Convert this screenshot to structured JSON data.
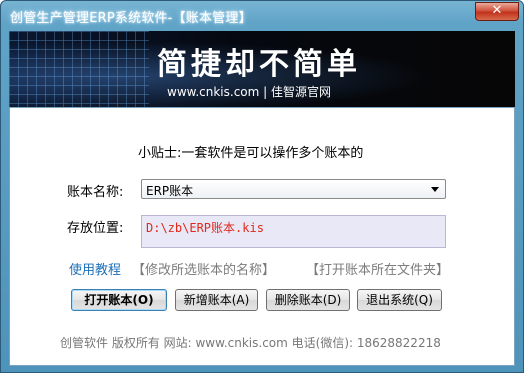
{
  "window": {
    "title": "创管生产管理ERP系统软件-【账本管理】",
    "close_glyph": "✕"
  },
  "banner": {
    "slogan": "简捷却不简单",
    "site": "www.cnkis.com | 佳智源官网"
  },
  "tip": "小贴士:一套软件是可以操作多个账本的",
  "form": {
    "ledger_name_label": "账本名称:",
    "ledger_name_value": "ERP账本",
    "location_label": "存放位置:",
    "location_value": "D:\\zb\\ERP账本.kis"
  },
  "links": {
    "tutorial": "使用教程",
    "rename": "【修改所选账本的名称】",
    "open_folder": "【打开账本所在文件夹】"
  },
  "buttons": {
    "open": "打开账本(O)",
    "new": "新增账本(A)",
    "delete": "删除账本(D)",
    "exit": "退出系统(Q)"
  },
  "footer": "创管软件 版权所有 网站: www.cnkis.com 电话(微信): 18628822218",
  "colors": {
    "title_bar": "#5fa3c7",
    "path_text": "#e0291b",
    "link": "#1c6fb8"
  }
}
